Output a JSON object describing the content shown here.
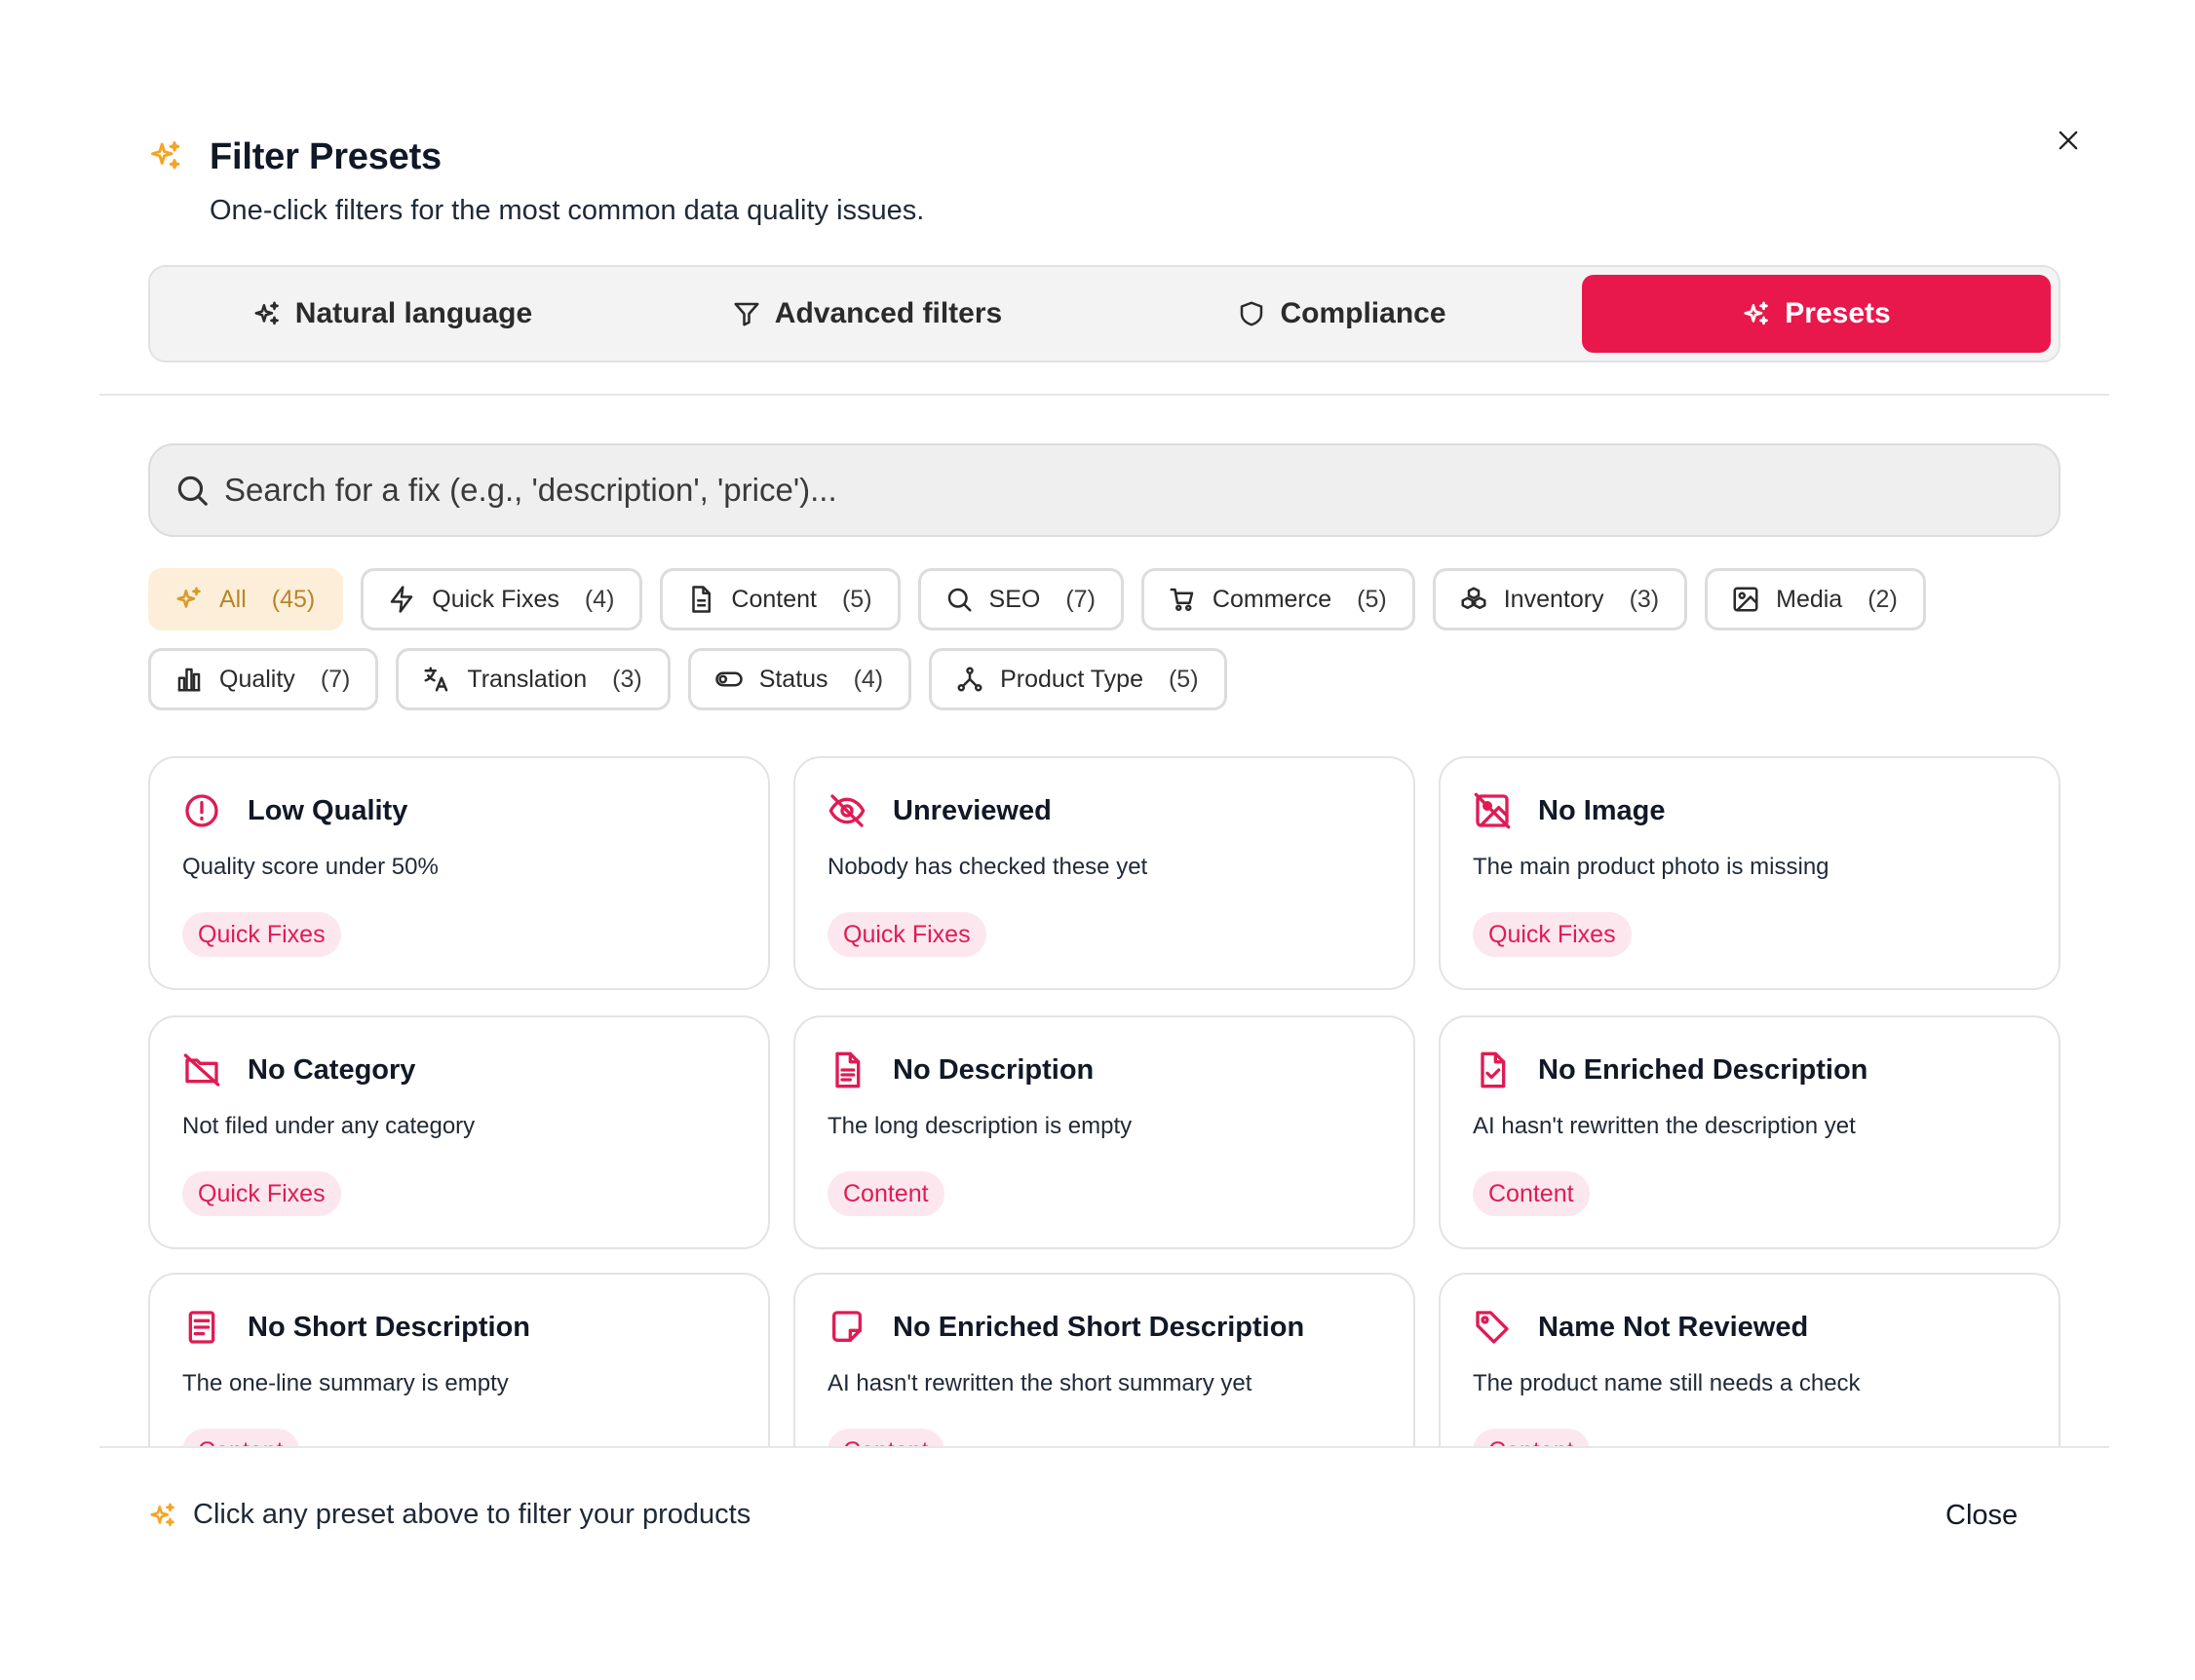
{
  "colors": {
    "accent": "#e8184c",
    "tag_bg": "#fde7ee",
    "tag_text": "#e01b54",
    "sparkle": "#f5a524",
    "active_chip_bg": "#fdeed9",
    "active_chip_text": "#b7862a"
  },
  "header": {
    "icon": "sparkles-icon",
    "title": "Filter Presets",
    "subtitle": "One-click filters for the most common data quality issues."
  },
  "tabs": [
    {
      "label": "Natural language",
      "icon": "sparkles-icon",
      "active": false
    },
    {
      "label": "Advanced filters",
      "icon": "filter-icon",
      "active": false
    },
    {
      "label": "Compliance",
      "icon": "shield-icon",
      "active": false
    },
    {
      "label": "Presets",
      "icon": "sparkles-icon",
      "active": true
    }
  ],
  "search": {
    "placeholder": "Search for a fix (e.g., 'description', 'price')...",
    "value": ""
  },
  "chips": [
    {
      "label": "All",
      "count": "(45)",
      "icon": "sparkles-icon",
      "active": true
    },
    {
      "label": "Quick Fixes",
      "count": "(4)",
      "icon": "zap-icon"
    },
    {
      "label": "Content",
      "count": "(5)",
      "icon": "document-icon"
    },
    {
      "label": "SEO",
      "count": "(7)",
      "icon": "search-icon"
    },
    {
      "label": "Commerce",
      "count": "(5)",
      "icon": "cart-icon"
    },
    {
      "label": "Inventory",
      "count": "(3)",
      "icon": "boxes-icon"
    },
    {
      "label": "Media",
      "count": "(2)",
      "icon": "image-icon"
    },
    {
      "label": "Quality",
      "count": "(7)",
      "icon": "bar-chart-icon"
    },
    {
      "label": "Translation",
      "count": "(3)",
      "icon": "translate-icon"
    },
    {
      "label": "Status",
      "count": "(4)",
      "icon": "toggle-icon"
    },
    {
      "label": "Product Type",
      "count": "(5)",
      "icon": "network-icon"
    }
  ],
  "presets": [
    {
      "title": "Low Quality",
      "description": "Quality score under 50%",
      "tag": "Quick Fixes",
      "icon": "alert-circle-icon"
    },
    {
      "title": "Unreviewed",
      "description": "Nobody has checked these yet",
      "tag": "Quick Fixes",
      "icon": "eye-off-icon"
    },
    {
      "title": "No Image",
      "description": "The main product photo is missing",
      "tag": "Quick Fixes",
      "icon": "image-off-icon"
    },
    {
      "title": "No Category",
      "description": "Not filed under any category",
      "tag": "Quick Fixes",
      "icon": "folder-off-icon"
    },
    {
      "title": "No Description",
      "description": "The long description is empty",
      "tag": "Content",
      "icon": "file-text-icon"
    },
    {
      "title": "No Enriched Description",
      "description": "AI hasn't rewritten the description yet",
      "tag": "Content",
      "icon": "file-check-icon"
    },
    {
      "title": "No Short Description",
      "description": "The one-line summary is empty",
      "tag": "Content",
      "icon": "receipt-icon"
    },
    {
      "title": "No Enriched Short Description",
      "description": "AI hasn't rewritten the short summary yet",
      "tag": "Content",
      "icon": "sticky-note-icon"
    },
    {
      "title": "Name Not Reviewed",
      "description": "The product name still needs a check",
      "tag": "Content",
      "icon": "tag-icon"
    }
  ],
  "footer": {
    "hint": "Click any preset above to filter your products",
    "close_label": "Close"
  }
}
